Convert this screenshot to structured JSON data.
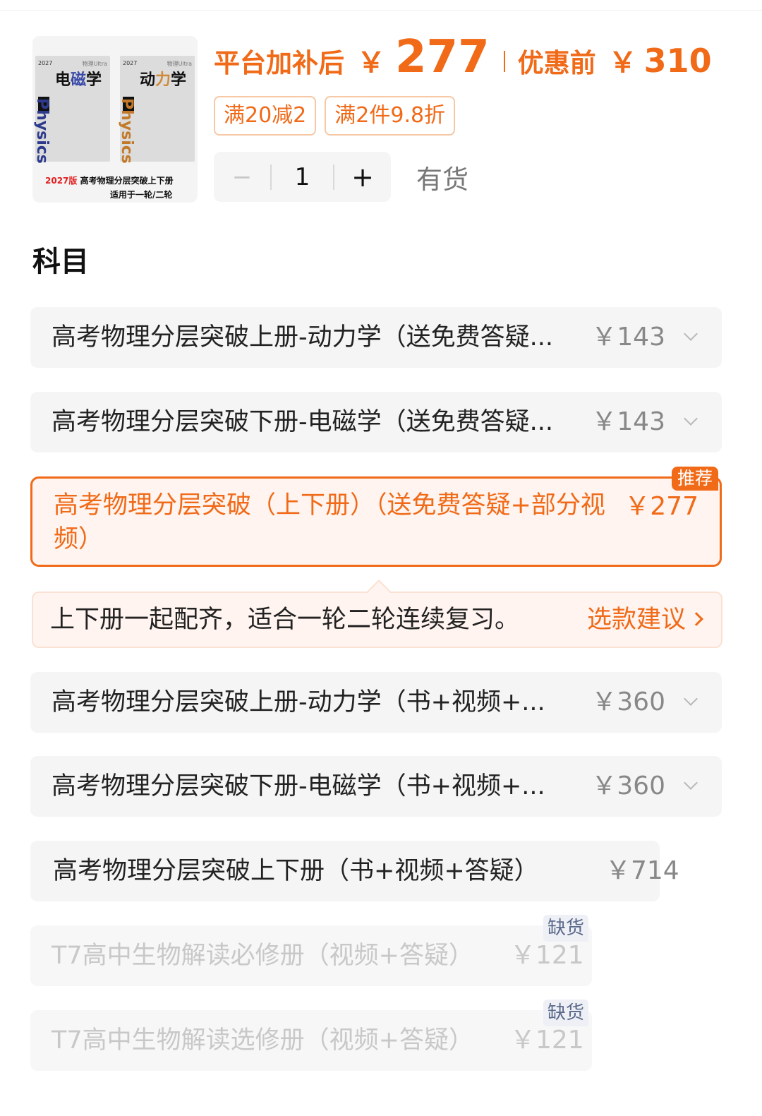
{
  "product": {
    "thumbnail": {
      "book1": {
        "year": "2027",
        "series": "物理Ultra",
        "title_plain": "电",
        "title_accent": "磁",
        "title_end": "学",
        "spine": "Physics"
      },
      "book2": {
        "year": "2027",
        "series": "物理Ultra",
        "title_plain": "动",
        "title_accent": "力",
        "title_end": "学",
        "spine": "Physics"
      },
      "caption_edition": "2027版",
      "caption_title": "高考物理分层突破上下册",
      "caption_sub": "适用于一轮/二轮"
    },
    "price_after_label": "平台加补后",
    "currency": "￥",
    "price_after": "277",
    "price_before_label": "优惠前",
    "price_before": "310",
    "coupons": [
      "满20减2",
      "满2件9.8折"
    ],
    "quantity": "1",
    "minus_symbol": "−",
    "plus_symbol": "+",
    "stock_status": "有货"
  },
  "section_title": "科目",
  "options": [
    {
      "name": "高考物理分层突破上册-动力学（送免费答疑...",
      "price": "￥143"
    },
    {
      "name": "高考物理分层突破下册-电磁学（送免费答疑...",
      "price": "￥143"
    },
    {
      "name": "高考物理分层突破（上下册）（送免费答疑+部分视频）",
      "price": "￥277",
      "tag": "推荐"
    },
    {
      "name": "高考物理分层突破上册-动力学（书+视频+...",
      "price": "￥360"
    },
    {
      "name": "高考物理分层突破下册-电磁学（书+视频+...",
      "price": "￥360"
    },
    {
      "name": "高考物理分层突破上下册（书+视频+答疑）",
      "price": "￥714"
    },
    {
      "name": "T7高中生物解读必修册（视频+答疑）",
      "price": "￥121",
      "tag": "缺货"
    },
    {
      "name": "T7高中生物解读选修册（视频+答疑）",
      "price": "￥121",
      "tag": "缺货"
    }
  ],
  "advice": {
    "text": "上下册一起配齐，适合一轮二轮连续复习。",
    "link": "选款建议"
  },
  "colors": {
    "accent": "#f06a18",
    "selected_bg": "#fff4ef",
    "option_bg": "#f5f5f5",
    "out_of_stock_tag": "#eef0f6"
  },
  "icons": [
    "chevron-down-icon",
    "chevron-right-icon"
  ]
}
